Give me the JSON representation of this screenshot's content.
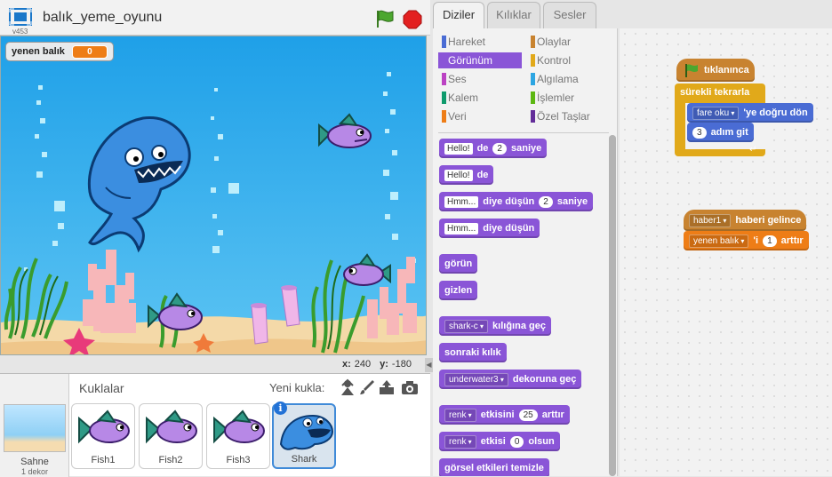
{
  "header": {
    "title": "balık_yeme_oyunu",
    "version": "v453"
  },
  "stage": {
    "monitor": {
      "label": "yenen balık",
      "value": "0"
    },
    "coords": {
      "x_label": "x:",
      "x_value": "240",
      "y_label": "y:",
      "y_value": "-180"
    }
  },
  "sprites": {
    "title": "Kuklalar",
    "new_sprite_label": "Yeni kukla:",
    "stage_label": "Sahne",
    "stage_sub": "1 dekor",
    "items": [
      {
        "name": "Fish1"
      },
      {
        "name": "Fish2"
      },
      {
        "name": "Fish3"
      },
      {
        "name": "Shark",
        "selected": true
      }
    ],
    "info_badge": "i"
  },
  "tabs": [
    {
      "label": "Diziler",
      "active": true
    },
    {
      "label": "Kılıklar",
      "active": false
    },
    {
      "label": "Sesler",
      "active": false
    }
  ],
  "categories": [
    {
      "label": "Hareket",
      "color": "#4a6cd4"
    },
    {
      "label": "Olaylar",
      "color": "#c88330"
    },
    {
      "label": "Görünüm",
      "color": "#8a55d7",
      "active": true
    },
    {
      "label": "Kontrol",
      "color": "#e1a91a"
    },
    {
      "label": "Ses",
      "color": "#bb42c3"
    },
    {
      "label": "Algılama",
      "color": "#2ca5e2"
    },
    {
      "label": "Kalem",
      "color": "#0e9a6c"
    },
    {
      "label": "İşlemler",
      "color": "#5cb712"
    },
    {
      "label": "Veri",
      "color": "#ee7d16"
    },
    {
      "label": "Özel Taşlar",
      "color": "#632d99"
    }
  ],
  "palette_blocks": {
    "say_for": {
      "slot": "Hello!",
      "t1": "de",
      "num": "2",
      "t2": "saniye"
    },
    "say": {
      "slot": "Hello!",
      "t1": "de"
    },
    "think_for": {
      "slot": "Hmm...",
      "t1": "diye düşün",
      "num": "2",
      "t2": "saniye"
    },
    "think": {
      "slot": "Hmm...",
      "t1": "diye düşün"
    },
    "show": {
      "t1": "görün"
    },
    "hide": {
      "t1": "gizlen"
    },
    "switch_costume": {
      "drop": "shark-c",
      "t1": "kılığına geç"
    },
    "next_costume": {
      "t1": "sonraki kılık"
    },
    "switch_backdrop": {
      "drop": "underwater3",
      "t1": "dekoruna geç"
    },
    "change_effect": {
      "drop": "renk",
      "t1": "etkisini",
      "num": "25",
      "t2": "arttır"
    },
    "set_effect": {
      "drop": "renk",
      "t1": "etkisi",
      "num": "0",
      "t2": "olsun"
    },
    "clear_effects": {
      "t1": "görsel etkileri temizle"
    }
  },
  "script1": {
    "hat": "tıklanınca",
    "forever": "sürekli tekrarla",
    "point_drop": "fare oku",
    "point_text": "'ye doğru dön",
    "move_num": "3",
    "move_text": "adım git"
  },
  "script2": {
    "hat_drop": "haber1",
    "hat_text": "haberi gelince",
    "change_drop": "yenen balık",
    "change_text1": "'i",
    "change_num": "1",
    "change_text2": "arttır"
  },
  "colors": {
    "looks": "#8a55d7",
    "motion": "#4a6cd4",
    "events": "#c88330",
    "control": "#e1a91a",
    "data": "#ee7d16",
    "stage_water": "#2aa6e8",
    "sand": "#f4d9a8"
  },
  "icons": {
    "fullscreen": "fullscreen-icon",
    "green_flag": "green-flag-icon",
    "stop": "stop-sign-icon",
    "library": "sprite-library-icon",
    "paint": "paintbrush-icon",
    "upload": "upload-icon",
    "camera": "camera-icon"
  }
}
